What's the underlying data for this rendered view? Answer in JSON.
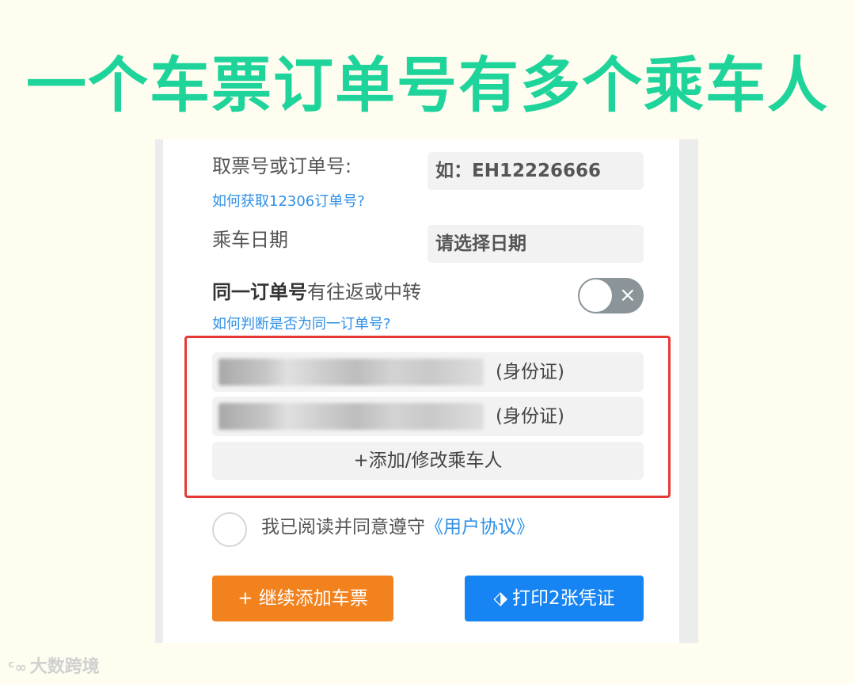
{
  "headline": "一个车票订单号有多个乘车人",
  "form": {
    "ticket_label": "取票号或订单号:",
    "ticket_placeholder": "如：EH12226666",
    "ticket_help": "如何获取12306订单号?",
    "date_label": "乘车日期",
    "date_placeholder": "请选择日期",
    "same_order_label_bold": "同一订单号",
    "same_order_label_rest": "有往返或中转",
    "same_order_help": "如何判断是否为同一订单号?",
    "toggle_icon": "close-icon",
    "toggle_state": "off"
  },
  "passengers": [
    {
      "id_type": "(身份证)"
    },
    {
      "id_type": "(身份证)"
    }
  ],
  "add_passenger_label": "+添加/修改乘车人",
  "agreement": {
    "text": "我已阅读并同意遵守",
    "link": "《用户协议》"
  },
  "buttons": {
    "continue_label": "+ 继续添加车票",
    "print_label": "打印2张凭证"
  },
  "watermark": "大数跨境",
  "colors": {
    "headline": "#1ed49a",
    "link": "#2f8fe6",
    "highlight_border": "#e53935",
    "orange_button": "#f2821e",
    "blue_button": "#1784f4"
  }
}
